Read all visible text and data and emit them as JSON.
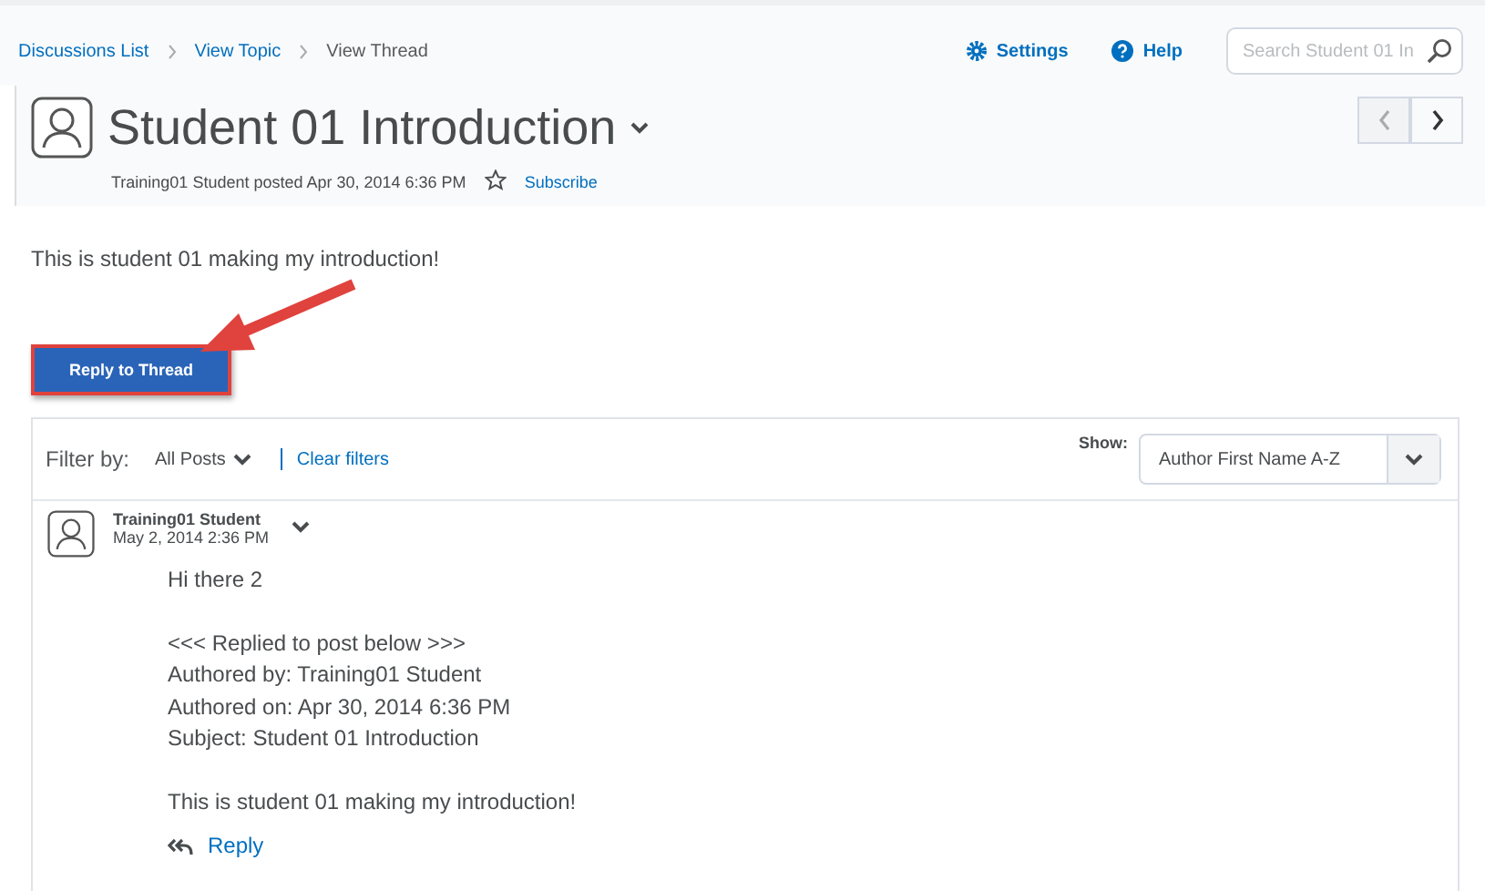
{
  "breadcrumbs": [
    {
      "label": "Discussions List",
      "kind": "link"
    },
    {
      "label": "View Topic",
      "kind": "link"
    },
    {
      "label": "View Thread",
      "kind": "current"
    }
  ],
  "toolbar": {
    "settings": "Settings",
    "help": "Help",
    "search": {
      "placeholder": "Search Student 01 In"
    }
  },
  "thread": {
    "title": "Student 01 Introduction",
    "meta": "Training01 Student posted Apr 30, 2014 6:36 PM",
    "subscribed": false,
    "subscribe": "Subscribe",
    "body": "This is student 01 making my introduction!",
    "reply_button": "Reply to Thread"
  },
  "filter": {
    "label": "Filter by:",
    "value": "All Posts",
    "clear": "Clear filters",
    "show_label": "Show:",
    "show_value": "Author First Name A-Z"
  },
  "posts": [
    {
      "author": "Training01 Student",
      "date": "May 2, 2014 2:36 PM",
      "lines": [
        {
          "text": "Hi there 2",
          "kind": "para"
        },
        {
          "text": "<<< Replied to post below >>>",
          "kind": "gap"
        },
        {
          "text": "Authored by: Training01 Student",
          "kind": "line"
        },
        {
          "text": "Authored on: Apr 30, 2014 6:36 PM",
          "kind": "line"
        },
        {
          "text": "Subject: Student 01 Introduction",
          "kind": "line"
        },
        {
          "text": "This is student 01 making my introduction!",
          "kind": "para"
        }
      ],
      "reply": "Reply"
    }
  ]
}
